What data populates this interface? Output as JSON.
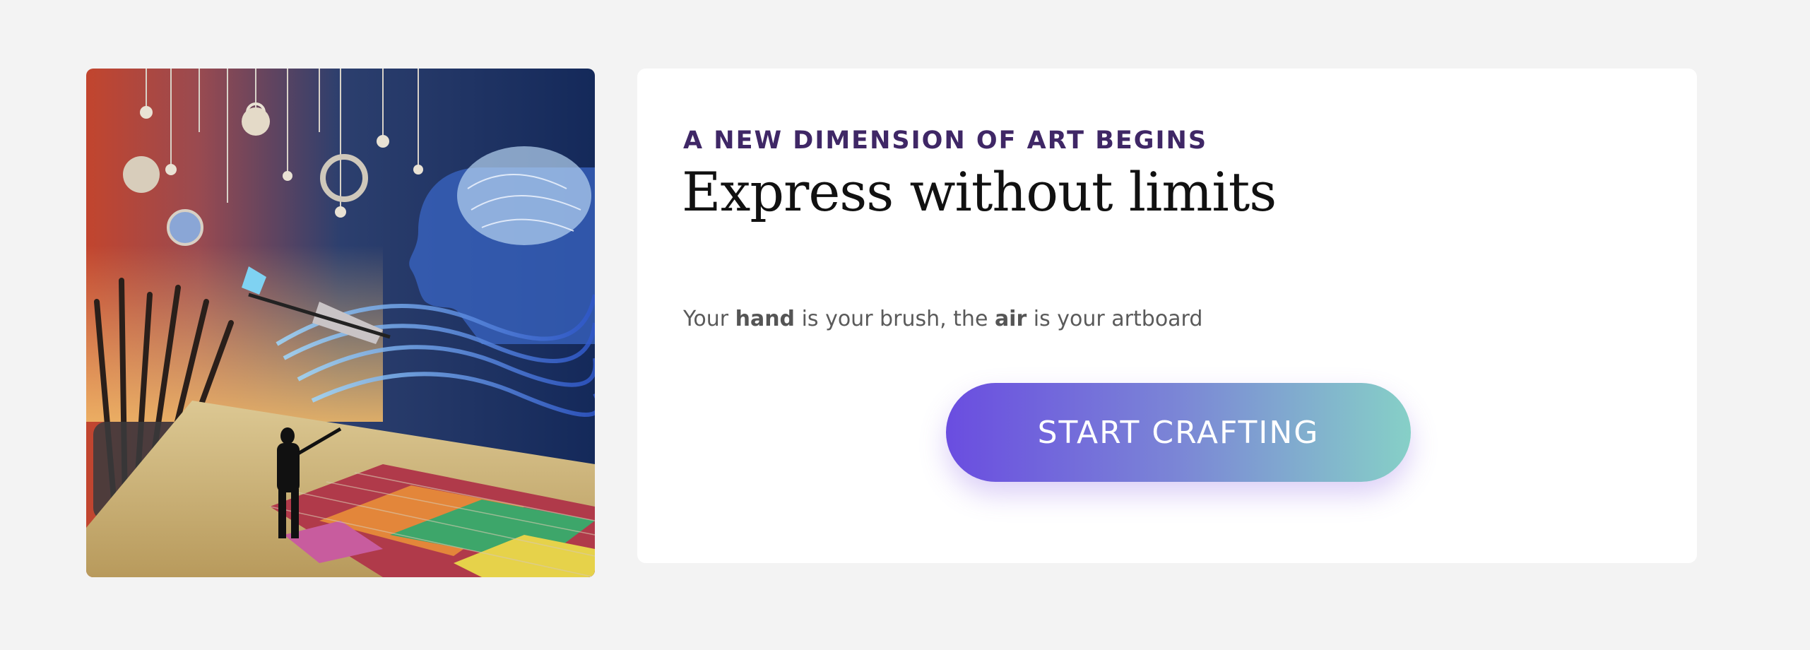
{
  "hero": {
    "eyebrow": "A NEW DIMENSION OF ART BEGINS",
    "headline": "Express without limits",
    "tagline": {
      "part1": "Your ",
      "bold1": "hand",
      "part2": " is your brush, the ",
      "bold2": "air",
      "part3": " is your artboard"
    },
    "cta_label": "START CRAFTING"
  },
  "colors": {
    "page_background": "#f3f3f3",
    "card_background": "#ffffff",
    "eyebrow": "#3f2766",
    "cta_gradient_start": "#6a4de0",
    "cta_gradient_end": "#86d0c7"
  }
}
